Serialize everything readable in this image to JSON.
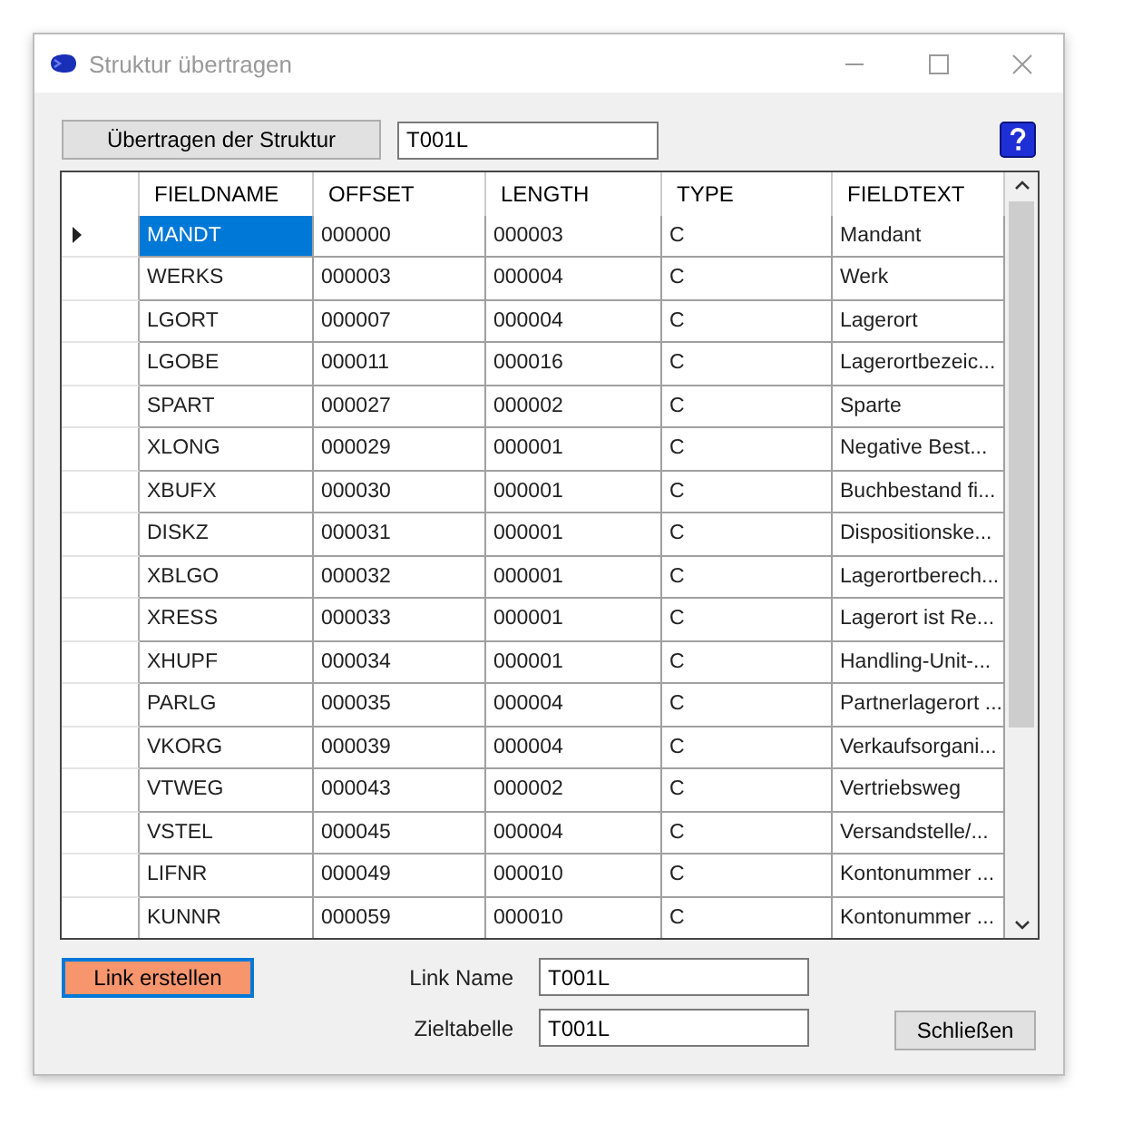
{
  "window": {
    "title": "Struktur übertragen"
  },
  "toolbar": {
    "transfer_button": "Übertragen der Struktur",
    "structure_field": {
      "value": "T001L"
    }
  },
  "table": {
    "columns": [
      "FIELDNAME",
      "OFFSET",
      "LENGTH",
      "TYPE",
      "FIELDTEXT"
    ],
    "rows": [
      {
        "cells": [
          "MANDT",
          "000000",
          "000003",
          "C",
          "Mandant"
        ],
        "selected": true
      },
      {
        "cells": [
          "WERKS",
          "000003",
          "000004",
          "C",
          "Werk"
        ],
        "selected": false
      },
      {
        "cells": [
          "LGORT",
          "000007",
          "000004",
          "C",
          "Lagerort"
        ],
        "selected": false
      },
      {
        "cells": [
          "LGOBE",
          "000011",
          "000016",
          "C",
          "Lagerortbezeic..."
        ],
        "selected": false
      },
      {
        "cells": [
          "SPART",
          "000027",
          "000002",
          "C",
          "Sparte"
        ],
        "selected": false
      },
      {
        "cells": [
          "XLONG",
          "000029",
          "000001",
          "C",
          "Negative Best..."
        ],
        "selected": false
      },
      {
        "cells": [
          "XBUFX",
          "000030",
          "000001",
          "C",
          "Buchbestand fi..."
        ],
        "selected": false
      },
      {
        "cells": [
          "DISKZ",
          "000031",
          "000001",
          "C",
          "Dispositionske..."
        ],
        "selected": false
      },
      {
        "cells": [
          "XBLGO",
          "000032",
          "000001",
          "C",
          "Lagerortberech..."
        ],
        "selected": false
      },
      {
        "cells": [
          "XRESS",
          "000033",
          "000001",
          "C",
          "Lagerort ist Re..."
        ],
        "selected": false
      },
      {
        "cells": [
          "XHUPF",
          "000034",
          "000001",
          "C",
          "Handling-Unit-..."
        ],
        "selected": false
      },
      {
        "cells": [
          "PARLG",
          "000035",
          "000004",
          "C",
          "Partnerlagerort ..."
        ],
        "selected": false
      },
      {
        "cells": [
          "VKORG",
          "000039",
          "000004",
          "C",
          "Verkaufsorgani..."
        ],
        "selected": false
      },
      {
        "cells": [
          "VTWEG",
          "000043",
          "000002",
          "C",
          "Vertriebsweg"
        ],
        "selected": false
      },
      {
        "cells": [
          "VSTEL",
          "000045",
          "000004",
          "C",
          "Versandstelle/..."
        ],
        "selected": false
      },
      {
        "cells": [
          "LIFNR",
          "000049",
          "000010",
          "C",
          "Kontonummer ..."
        ],
        "selected": false
      },
      {
        "cells": [
          "KUNNR",
          "000059",
          "000010",
          "C",
          "Kontonummer ..."
        ],
        "selected": false
      }
    ]
  },
  "footer": {
    "link_button": "Link erstellen",
    "link_name": {
      "label": "Link Name",
      "value": "T001L"
    },
    "target_table": {
      "label": "Zieltabelle",
      "value": "T001L"
    },
    "close_button": "Schließen"
  }
}
